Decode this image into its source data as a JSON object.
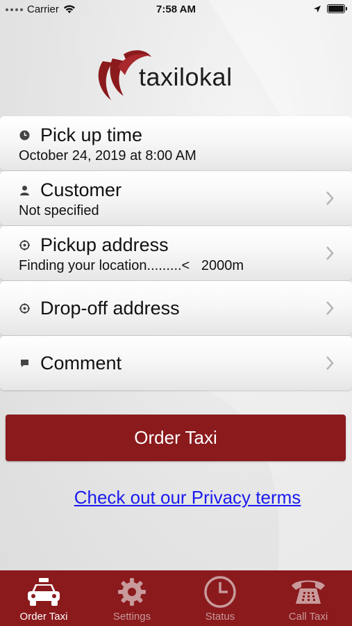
{
  "status_bar": {
    "carrier": "Carrier",
    "time": "7:58 AM"
  },
  "app": {
    "logo_text": "taxilokal"
  },
  "rows": [
    {
      "icon": "clock-icon",
      "title": "Pick up time",
      "subtitle": "October 24, 2019 at 8:00 AM",
      "chevron": false
    },
    {
      "icon": "person-icon",
      "title": "Customer",
      "subtitle": "Not specified",
      "chevron": true
    },
    {
      "icon": "target-icon",
      "title": "Pickup address",
      "subtitle": "Finding your location.........<   2000m",
      "chevron": true
    },
    {
      "icon": "target-icon",
      "title": "Drop-off address",
      "subtitle": "",
      "chevron": true
    },
    {
      "icon": "comment-icon",
      "title": "Comment",
      "subtitle": "",
      "chevron": true
    }
  ],
  "order_button": {
    "label": "Order Taxi"
  },
  "privacy_link": {
    "label": "Check out our Privacy terms"
  },
  "tabs": [
    {
      "label": "Order Taxi",
      "icon": "taxi-icon",
      "active": true
    },
    {
      "label": "Settings",
      "icon": "gear-icon",
      "active": false
    },
    {
      "label": "Status",
      "icon": "clock-icon",
      "active": false
    },
    {
      "label": "Call Taxi",
      "icon": "phone-icon",
      "active": false
    }
  ],
  "colors": {
    "brand": "#8b1a1d",
    "link": "#1a1aee",
    "tab_inactive": "#c89a9b"
  }
}
